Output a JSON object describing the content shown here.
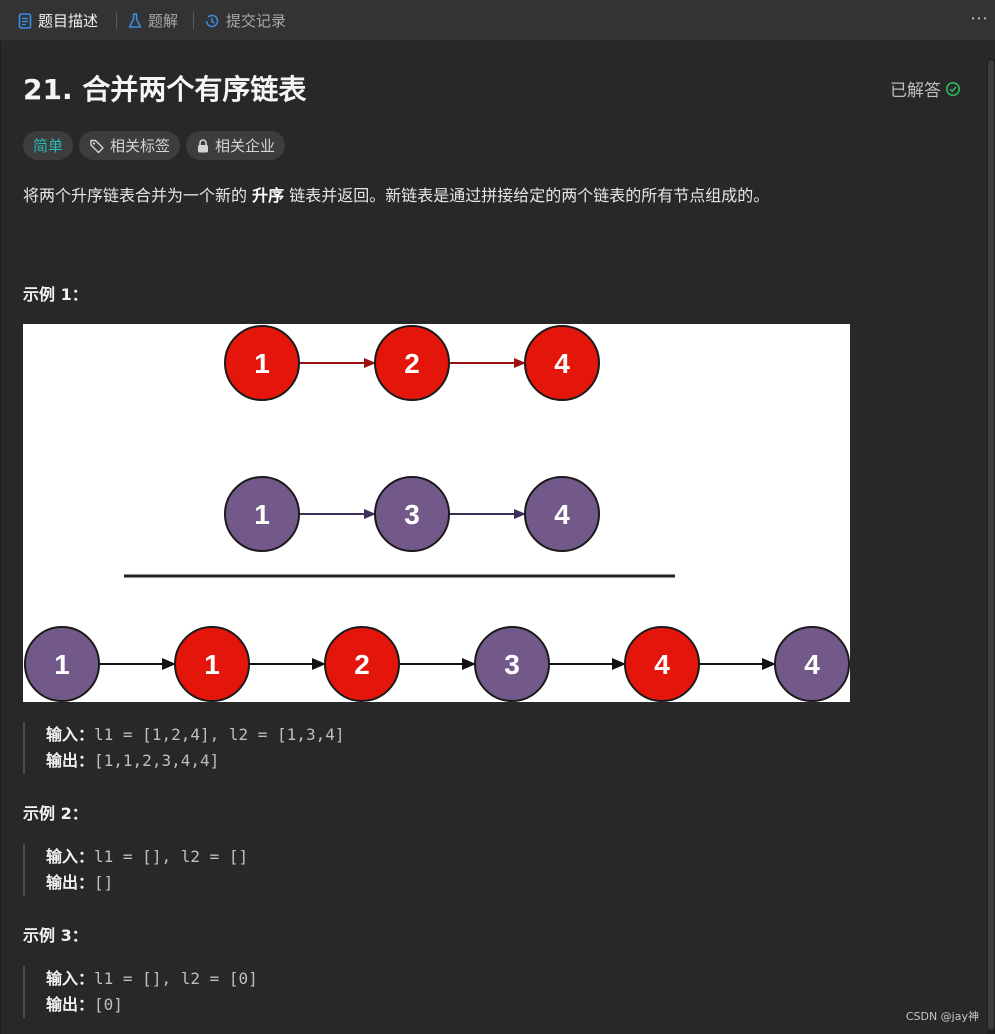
{
  "tabs": {
    "description": "题目描述",
    "solution": "题解",
    "submissions": "提交记录"
  },
  "problem": {
    "title": "21. 合并两个有序链表",
    "status": "已解答",
    "difficulty": "简单",
    "tags_label": "相关标签",
    "companies_label": "相关企业",
    "description_pre": "将两个升序链表合并为一个新的 ",
    "description_bold": "升序",
    "description_post": " 链表并返回。新链表是通过拼接给定的两个链表的所有节点组成的。"
  },
  "labels": {
    "input": "输入：",
    "output": "输出："
  },
  "examples": [
    {
      "title": "示例 1：",
      "input": "l1 = [1,2,4], l2 = [1,3,4]",
      "output": "[1,1,2,3,4,4]"
    },
    {
      "title": "示例 2：",
      "input": "l1 = [], l2 = []",
      "output": "[]"
    },
    {
      "title": "示例 3：",
      "input": "l1 = [], l2 = [0]",
      "output": "[0]"
    }
  ],
  "figure": {
    "list1": [
      "1",
      "2",
      "4"
    ],
    "list2": [
      "1",
      "3",
      "4"
    ],
    "merged": [
      "1",
      "1",
      "2",
      "3",
      "4",
      "4"
    ],
    "merged_colors": [
      "purple",
      "red",
      "red",
      "purple",
      "red",
      "purple"
    ],
    "colors": {
      "red": "#e4160b",
      "purple": "#73598a"
    }
  },
  "watermark": "CSDN @jay神",
  "colors": {
    "accent": "#2db7b5",
    "success": "#2cbb5d",
    "tab_icon": "#3b8eea"
  }
}
